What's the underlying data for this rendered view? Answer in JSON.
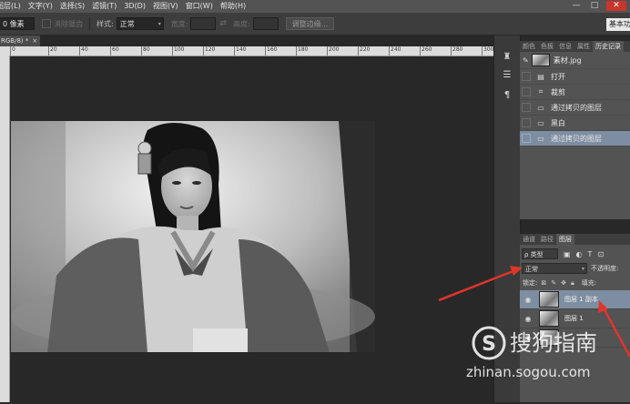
{
  "menubar": {
    "items": [
      "图层(L)",
      "文字(Y)",
      "选择(S)",
      "滤镜(T)",
      "3D(D)",
      "视图(V)",
      "窗口(W)",
      "帮助(H)"
    ],
    "window_buttons": [
      "—",
      "□",
      "✕"
    ]
  },
  "options": {
    "feather_value": "0 像素",
    "antialias_label": "消除锯齿",
    "style_label": "样式:",
    "style_value": "正常",
    "width_label": "宽度:",
    "height_label": "高度:",
    "refine_edge_button": "调整边缘...",
    "workspace": "基本功能"
  },
  "document": {
    "tab_label": "RGB/8) *",
    "tab_close": "×",
    "ruler_ticks": [
      "0",
      "20",
      "40",
      "60",
      "80",
      "100",
      "120",
      "140",
      "160",
      "180",
      "200",
      "220",
      "240",
      "260",
      "280",
      "300"
    ]
  },
  "history_panel": {
    "tabs": [
      "颜色",
      "色板",
      "信息",
      "属性",
      "历史记录"
    ],
    "snapshot": "素材.jpg",
    "steps": [
      {
        "icon": "open-icon",
        "label": "打开",
        "selected": false
      },
      {
        "icon": "crop-icon",
        "label": "裁剪",
        "selected": false
      },
      {
        "icon": "layer-icon",
        "label": "通过拷贝的图层",
        "selected": false
      },
      {
        "icon": "adjust-icon",
        "label": "黑白",
        "selected": false
      },
      {
        "icon": "layer-icon",
        "label": "通过拷贝的图层",
        "selected": true
      }
    ]
  },
  "layers_panel": {
    "tabs": [
      "通道",
      "路径",
      "图层"
    ],
    "filter_kind": "ρ 类型",
    "blend_mode": "正常",
    "opacity_label": "不透明度:",
    "lock_label": "锁定:",
    "fill_label": "填充:",
    "layers": [
      {
        "name": "图层 1 副本",
        "selected": true
      },
      {
        "name": "图层 1",
        "selected": false
      }
    ]
  },
  "watermark": {
    "logo_letter": "S",
    "brand": "搜狗指南",
    "url": "zhinan.sogou.com"
  },
  "colors": {
    "annotation_arrow": "#e0352b",
    "selection": "#7e8ea2"
  }
}
